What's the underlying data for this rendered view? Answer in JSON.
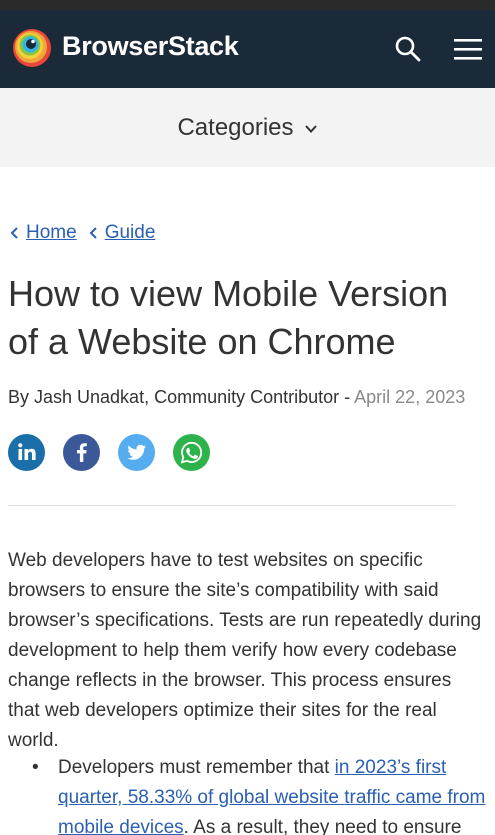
{
  "header": {
    "brand": "BrowserStack",
    "logo_icon": "browserstack-logo",
    "search_icon": "search-icon",
    "menu_icon": "hamburger-menu-icon",
    "bg_color": "#1b2a38"
  },
  "categories": {
    "label": "Categories",
    "chevron_icon": "chevron-down-icon"
  },
  "breadcrumb": {
    "items": [
      {
        "label": "Home"
      },
      {
        "label": "Guide"
      }
    ]
  },
  "article": {
    "title": "How to view Mobile Version of a Website on Chrome",
    "author": "By Jash Unadkat, Community Contributor -",
    "date": "April 22, 2023",
    "intro": "Web developers have to test websites on specific browsers to ensure the site’s compatibility with said browser’s specifications. Tests are run repeatedly during development to help them verify how every codebase change reflects in the browser. This process ensures that web developers optimize their sites for the real world.",
    "bullet_1_prefix": "Developers must remember that",
    "bullet_1_link": "in 2023’s first quarter, 58.33% of global website traffic came from mobile devices",
    "bullet_1_suffix": ". As a result, they need to ensure"
  },
  "social": [
    {
      "name": "linkedin-icon",
      "color": "#1a6fa8"
    },
    {
      "name": "facebook-icon",
      "color": "#3b5998"
    },
    {
      "name": "twitter-icon",
      "color": "#55acee"
    },
    {
      "name": "whatsapp-icon",
      "color": "#2eb24b"
    }
  ],
  "link_color": "#2a5fb3"
}
